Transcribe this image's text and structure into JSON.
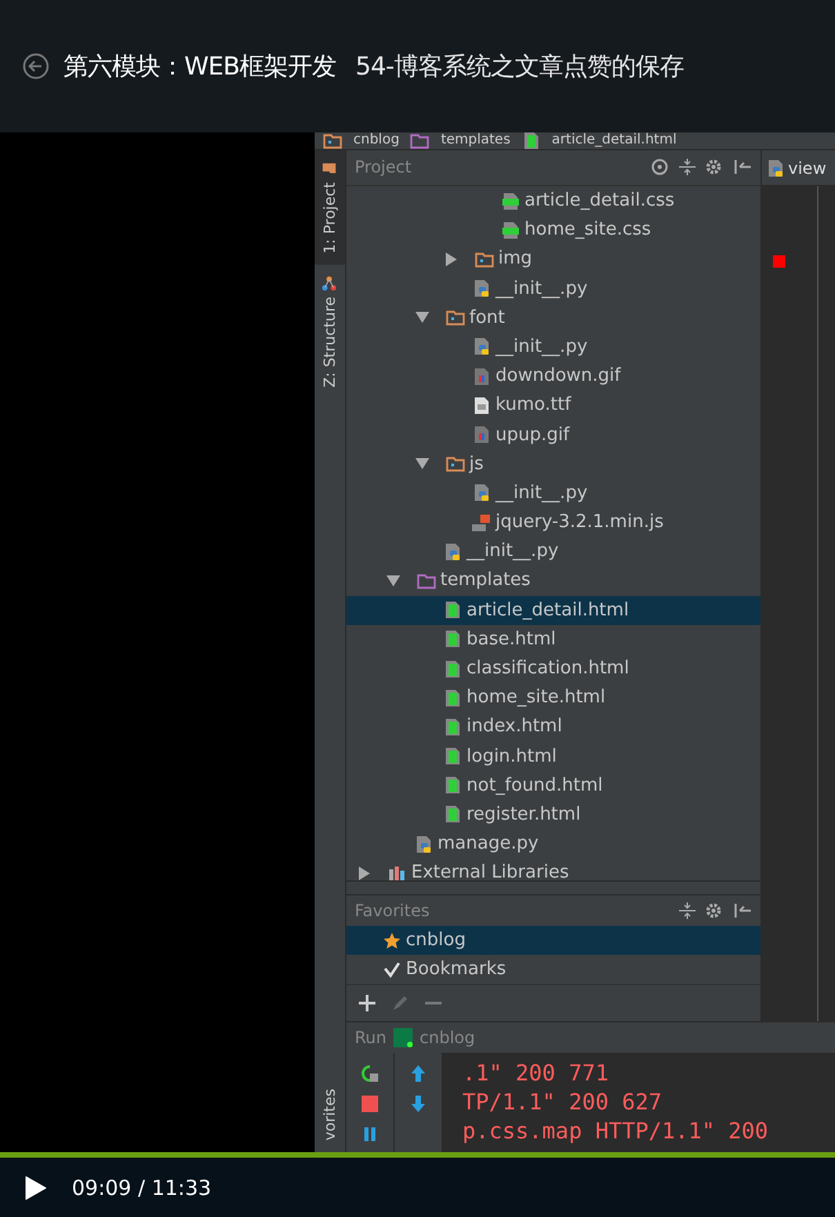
{
  "header": {
    "course": "第六模块：WEB框架开发",
    "lesson": "54-博客系统之文章点赞的保存"
  },
  "ide": {
    "breadcrumbs": [
      {
        "label": "cnblog",
        "kind": "folder"
      },
      {
        "label": "templates",
        "kind": "template_folder"
      },
      {
        "label": "article_detail.html",
        "kind": "html"
      }
    ],
    "side_tabs": [
      {
        "label": "1: Project",
        "selected": true,
        "kind": "project"
      },
      {
        "label": "Z: Structure",
        "selected": false,
        "kind": "structure"
      }
    ],
    "bottom_side_tab": {
      "label": "vorites"
    },
    "project": {
      "title": "Project",
      "tree": [
        {
          "children": [
            {
              "children": [
                {
                  "children": [
                    {
                      "children": [
                        {
                          "name": "article_detail.css",
                          "kind": "css",
                          "selected": false
                        },
                        {
                          "name": "home_site.css",
                          "kind": "css",
                          "selected": false
                        }
                      ]
                    },
                    {
                      "name": "img",
                      "kind": "folder",
                      "expanded": false,
                      "selected": false
                    },
                    {
                      "name": "__init__.py",
                      "kind": "python",
                      "selected": false
                    }
                  ]
                },
                {
                  "name": "font",
                  "kind": "folder",
                  "expanded": true,
                  "selected": false,
                  "children": [
                    {
                      "name": "__init__.py",
                      "kind": "python",
                      "selected": false
                    },
                    {
                      "name": "downdown.gif",
                      "kind": "image",
                      "selected": false
                    },
                    {
                      "name": "kumo.ttf",
                      "kind": "font",
                      "selected": false
                    },
                    {
                      "name": "upup.gif",
                      "kind": "image",
                      "selected": false
                    }
                  ]
                },
                {
                  "name": "js",
                  "kind": "folder",
                  "expanded": true,
                  "selected": false,
                  "children": [
                    {
                      "name": "__init__.py",
                      "kind": "python",
                      "selected": false
                    },
                    {
                      "name": "jquery-3.2.1.min.js",
                      "kind": "js",
                      "selected": false
                    }
                  ]
                },
                {
                  "name": "__init__.py",
                  "kind": "python",
                  "selected": false
                }
              ]
            },
            {
              "name": "templates",
              "kind": "template_folder",
              "expanded": true,
              "selected": false,
              "children": [
                {
                  "name": "article_detail.html",
                  "kind": "html",
                  "selected": true
                },
                {
                  "name": "base.html",
                  "kind": "html",
                  "selected": false
                },
                {
                  "name": "classification.html",
                  "kind": "html",
                  "selected": false
                },
                {
                  "name": "home_site.html",
                  "kind": "html",
                  "selected": false
                },
                {
                  "name": "index.html",
                  "kind": "html",
                  "selected": false
                },
                {
                  "name": "login.html",
                  "kind": "html",
                  "selected": false
                },
                {
                  "name": "not_found.html",
                  "kind": "html",
                  "selected": false
                },
                {
                  "name": "register.html",
                  "kind": "html",
                  "selected": false
                }
              ]
            },
            {
              "name": "manage.py",
              "kind": "python",
              "selected": false
            }
          ]
        },
        {
          "name": "External Libraries",
          "kind": "library",
          "expanded": false,
          "selected": false
        }
      ]
    },
    "favorites": {
      "title": "Favorites",
      "items": [
        {
          "label": "cnblog",
          "kind": "star",
          "selected": true
        },
        {
          "label": "Bookmarks",
          "kind": "check",
          "selected": false
        }
      ]
    },
    "editor": {
      "tab": "view"
    },
    "run": {
      "label": "Run",
      "config": "cnblog",
      "lines": [
        ".1\" 200 771",
        "TP/1.1\" 200 627",
        "p.css.map HTTP/1.1\" 200"
      ]
    }
  },
  "player": {
    "playing": false,
    "time": "09:09 / 11:33"
  }
}
